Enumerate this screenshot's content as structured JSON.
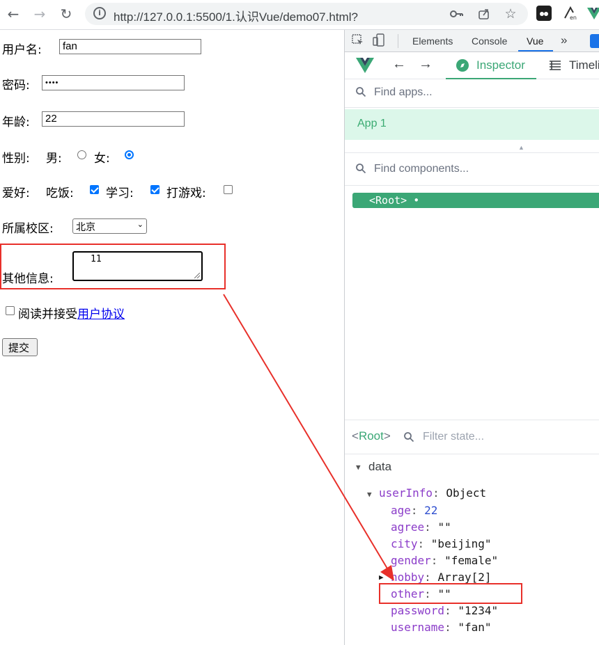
{
  "browser": {
    "url": "http://127.0.0.1:5500/1.认识Vue/demo07.html?"
  },
  "form": {
    "username_label": "用户名:",
    "username_value": "fan",
    "password_label": "密码:",
    "password_mask": "••••",
    "age_label": "年龄:",
    "age_value": "22",
    "gender_label": "性别:",
    "gender_male": "男:",
    "gender_female": "女:",
    "hobby_label": "爱好:",
    "hobby_eat": "吃饭:",
    "hobby_study": "学习:",
    "hobby_game": "打游戏:",
    "campus_label": "所属校区:",
    "campus_selected": "北京",
    "other_label": "其他信息:",
    "other_value": "11",
    "agree_text": "阅读并接受",
    "agree_link": "用户协议",
    "submit_label": "提交"
  },
  "devtools": {
    "tabs": [
      "Elements",
      "Console",
      "Vue"
    ],
    "more_tabs": "»",
    "active_tab": "Vue",
    "vue": {
      "inspector_label": "Inspector",
      "timeline_label": "Timeli",
      "find_apps_placeholder": "Find apps...",
      "app_item": "App 1",
      "find_components_placeholder": "Find components...",
      "root_node": "<Root> •",
      "state_root_open": "<",
      "state_root_name": "Root",
      "state_root_close": ">",
      "filter_state_placeholder": "Filter state...",
      "data_section": "data",
      "userinfo_key": "userInfo",
      "userinfo_type": "Object",
      "fields": [
        {
          "key": "age",
          "value": "22",
          "kind": "num"
        },
        {
          "key": "agree",
          "value": "\"\"",
          "kind": "str"
        },
        {
          "key": "city",
          "value": "\"beijing\"",
          "kind": "str"
        },
        {
          "key": "gender",
          "value": "\"female\"",
          "kind": "str"
        },
        {
          "key": "hobby",
          "value": "Array[2]",
          "kind": "str"
        },
        {
          "key": "other",
          "value": "\"\"",
          "kind": "str"
        },
        {
          "key": "password",
          "value": "\"1234\"",
          "kind": "str"
        },
        {
          "key": "username",
          "value": "\"fan\"",
          "kind": "str"
        }
      ]
    }
  },
  "colors": {
    "vue_green": "#3ba776",
    "highlight_red": "#e8302a",
    "accent_blue": "#0075ff"
  }
}
